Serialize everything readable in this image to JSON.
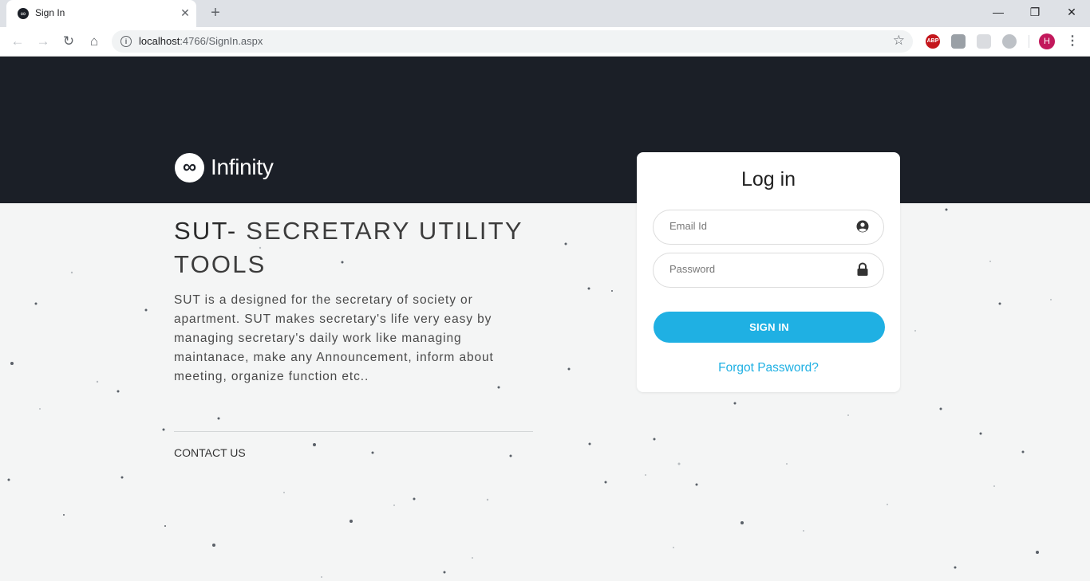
{
  "browser": {
    "tab_title": "Sign In",
    "tab_close": "✕",
    "new_tab": "+",
    "url_host": "localhost",
    "url_path": ":4766/SignIn.aspx",
    "avatar_letter": "H",
    "ext_abp": "ABP",
    "window_controls": {
      "minimize": "—",
      "maximize": "❐",
      "close": "✕"
    }
  },
  "brand": {
    "name": "Infinity",
    "logo_symbol": "∞"
  },
  "hero": {
    "headline_bold": "SUT-",
    "headline_rest": " SECRETARY UTILITY TOOLS",
    "description": "SUT is a designed for the secretary of society or apartment. SUT makes secretary's life very easy by managing secretary's daily work like managing maintanace, make any Announcement, inform about meeting, organize function etc..",
    "contact_label": "CONTACT US"
  },
  "login": {
    "title": "Log in",
    "email_placeholder": "Email Id",
    "password_placeholder": "Password",
    "signin_label": "SIGN IN",
    "forgot_label": "Forgot Password?"
  },
  "colors": {
    "dark": "#1b1f27",
    "accent": "#1fb0e3",
    "page_bg": "#f4f5f5"
  },
  "icons": {
    "email_field": "user-circle-icon",
    "password_field": "lock-icon"
  }
}
